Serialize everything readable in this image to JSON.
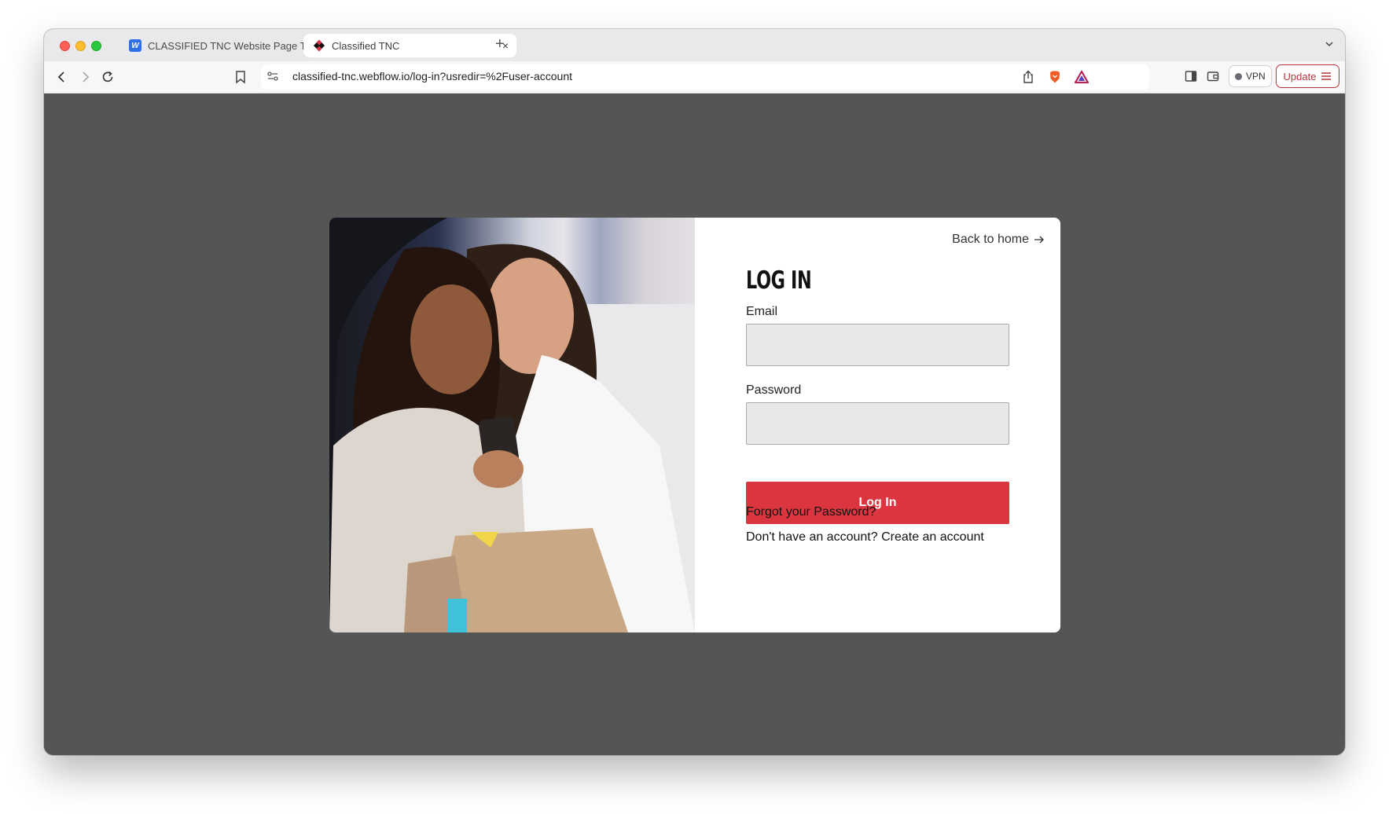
{
  "browser": {
    "tabs": [
      {
        "label": "CLASSIFIED TNC Website Page Tem",
        "active": false
      },
      {
        "label": "Classified TNC",
        "active": true
      }
    ],
    "tab_close": "×",
    "new_tab": "+",
    "url": "classified-tnc.webflow.io/log-in?usredir=%2Fuser-account",
    "vpn_label": "VPN",
    "update_label": "Update"
  },
  "login": {
    "back_to_home": "Back to home",
    "title": "LOG IN",
    "email_label": "Email",
    "email_value": "",
    "password_label": "Password",
    "password_value": "",
    "submit_label": "Log In",
    "forgot_password": "Forgot your Password?",
    "create_account": "Don't have an account? Create an account"
  },
  "colors": {
    "accent": "#db3640",
    "page_background": "#555555",
    "input_background": "#e8e8e8"
  }
}
